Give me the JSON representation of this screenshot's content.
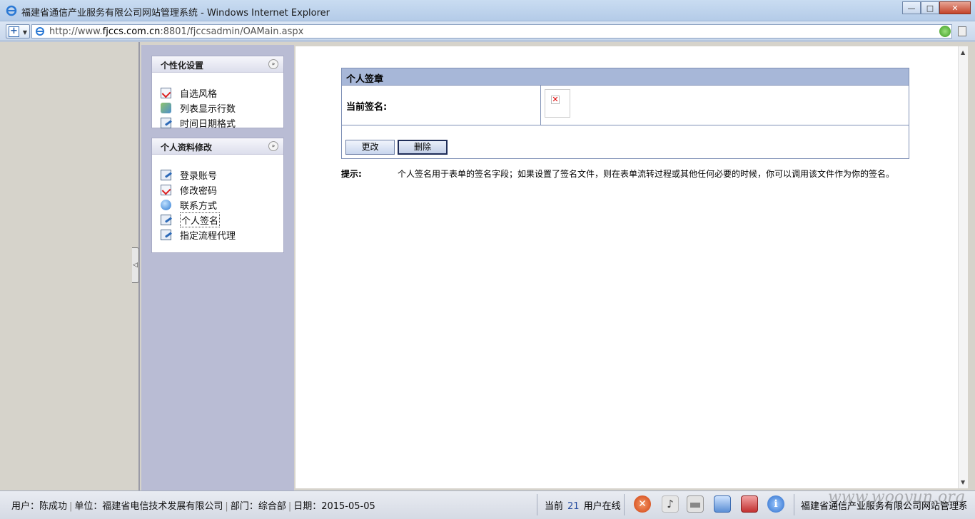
{
  "browser": {
    "window_title": "福建省通信产业服务有限公司网站管理系统 - Windows Internet Explorer",
    "url_prefix": "http://www.",
    "url_domain": "fjccs.com.cn",
    "url_path": ":8801/fjccsadmin/OAMain.aspx",
    "window_buttons": {
      "minimize": "—",
      "maximize": "□",
      "close": "✕"
    }
  },
  "sidebar": {
    "panels": [
      {
        "title": "个性化设置",
        "items": [
          {
            "label": "自选风格",
            "icon": "doc-check-icon"
          },
          {
            "label": "列表显示行数",
            "icon": "list-icon"
          },
          {
            "label": "时间日期格式",
            "icon": "edit-icon"
          }
        ]
      },
      {
        "title": "个人资料修改",
        "items": [
          {
            "label": "登录账号",
            "icon": "edit-icon"
          },
          {
            "label": "修改密码",
            "icon": "doc-check-icon"
          },
          {
            "label": "联系方式",
            "icon": "globe-icon"
          },
          {
            "label": "个人签名",
            "icon": "edit-icon",
            "active": true
          },
          {
            "label": "指定流程代理",
            "icon": "edit-icon"
          }
        ]
      }
    ]
  },
  "signature": {
    "header": "个人签章",
    "current_label": "当前签名:",
    "change_button": "更改",
    "delete_button": "删除",
    "hint_label": "提示:",
    "hint_text": "个人签名用于表单的签名字段；如果设置了签名文件，则在表单流转过程或其他任何必要的时候，你可以调用该文件作为你的签名。"
  },
  "status": {
    "user": "用户：陈成功",
    "unit": "单位：福建省电信技术发展有限公司",
    "dept": "部门：综合部",
    "date": "日期：2015-05-05",
    "online_prefix": "当前",
    "online_count": "21",
    "online_suffix": "用户在线",
    "system_name": "福建省通信产业服务有限公司网站管理系统"
  },
  "watermark": "www.wooyun.org",
  "colors": {
    "table_header": "#a7b7d8",
    "menu_background": "#b9bcd4",
    "table_border": "#7e8fb5"
  }
}
